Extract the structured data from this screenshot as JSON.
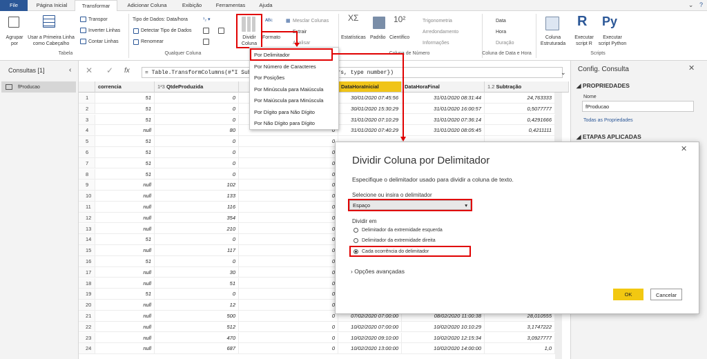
{
  "tabs": [
    "File",
    "Página Inicial",
    "Transformar",
    "Adicionar Coluna",
    "Exibição",
    "Ferramentas",
    "Ajuda"
  ],
  "ribbon": {
    "tabela": {
      "agrupar": "Agrupar por",
      "usar_primeira": "Usar a Primeira Linha como Cabeçalho",
      "transpor": "Transpor",
      "inverter": "Inverter Linhas",
      "contar": "Contar Linhas",
      "group": "Tabela"
    },
    "qualquer": {
      "tipo": "Tipo de Dados: Data/hora",
      "detectar": "Detectar Tipo de Dados",
      "renomear": "Renomear",
      "dividir": "Dividir Coluna",
      "formato": "Formato",
      "mesclar": "Mesclar Colunas",
      "extrair": "Extrair",
      "analisar": "Analisar",
      "group": "Qualquer Coluna"
    },
    "numero": {
      "estatisticas": "Estatísticas",
      "padrao": "Padrão",
      "cientifico": "Científico",
      "trig": "Trigonometria",
      "arred": "Arredondamento",
      "info": "Informações",
      "group": "Coluna de Número"
    },
    "data": {
      "data": "Data",
      "hora": "Hora",
      "duracao": "Duração",
      "group": "Coluna de Data e Hora"
    },
    "estruturada": "Coluna Estruturada",
    "scripts": {
      "r": "Executar script R",
      "py": "Executar script Python",
      "group": "Scripts"
    }
  },
  "left": {
    "title": "Consultas [1]",
    "query": "fProducao"
  },
  "formula": "= Table.TransformColumns(#\"I                                  Subtração\", Duration.TotalHours, type number})",
  "columns": [
    "correncia",
    "QtdeProduzida",
    "",
    "DataHoraInicial",
    "DataHoraFinal",
    "Subtração"
  ],
  "rows": [
    [
      "1",
      "51",
      "0",
      "0",
      "30/01/2020 07:45:56",
      "31/01/2020 08:31:44",
      "24,763333"
    ],
    [
      "2",
      "51",
      "0",
      "0",
      "30/01/2020 15:30:29",
      "31/01/2020 16:00:57",
      "0,5077777"
    ],
    [
      "3",
      "51",
      "0",
      "0",
      "31/01/2020 07:10:29",
      "31/01/2020 07:36:14",
      "0,4291666"
    ],
    [
      "4",
      "null",
      "80",
      "0",
      "31/01/2020 07:40:29",
      "31/01/2020 08:05:45",
      "0,4211111"
    ],
    [
      "5",
      "51",
      "0",
      "0",
      "",
      "",
      ""
    ],
    [
      "6",
      "51",
      "0",
      "0",
      "",
      "",
      ""
    ],
    [
      "7",
      "51",
      "0",
      "0",
      "",
      "",
      ""
    ],
    [
      "8",
      "51",
      "0",
      "0",
      "",
      "",
      ""
    ],
    [
      "9",
      "null",
      "102",
      "0",
      "",
      "",
      ""
    ],
    [
      "10",
      "null",
      "133",
      "0",
      "",
      "",
      ""
    ],
    [
      "11",
      "null",
      "116",
      "0",
      "",
      "",
      ""
    ],
    [
      "12",
      "null",
      "354",
      "0",
      "",
      "",
      ""
    ],
    [
      "13",
      "null",
      "210",
      "0",
      "",
      "",
      ""
    ],
    [
      "14",
      "51",
      "0",
      "0",
      "",
      "",
      ""
    ],
    [
      "15",
      "null",
      "117",
      "0",
      "",
      "",
      ""
    ],
    [
      "16",
      "51",
      "0",
      "0",
      "",
      "",
      ""
    ],
    [
      "17",
      "null",
      "30",
      "0",
      "",
      "",
      ""
    ],
    [
      "18",
      "null",
      "51",
      "0",
      "",
      "",
      ""
    ],
    [
      "19",
      "51",
      "0",
      "0",
      "",
      "",
      ""
    ],
    [
      "20",
      "null",
      "12",
      "0",
      "",
      "",
      ""
    ],
    [
      "21",
      "null",
      "500",
      "0",
      "07/02/2020 07:00:00",
      "08/02/2020 11:00:38",
      "28,010555"
    ],
    [
      "22",
      "null",
      "512",
      "0",
      "10/02/2020 07:00:00",
      "10/02/2020 10:10:29",
      "3,1747222"
    ],
    [
      "23",
      "null",
      "470",
      "0",
      "10/02/2020 09:10:00",
      "10/02/2020 12:15:34",
      "3,0927777"
    ],
    [
      "24",
      "null",
      "687",
      "0",
      "10/02/2020 13:00:00",
      "10/02/2020 14:00:00",
      "1,0"
    ]
  ],
  "menu": [
    "Por Delimitador",
    "Por Número de Caracteres",
    "Por Posições",
    "Por Minúscula para Maiúscula",
    "Por Maiúscula para Minúscula",
    "Por Dígito para Não Dígito",
    "Por Não Dígito para Dígito"
  ],
  "right": {
    "title": "Config. Consulta",
    "props": "PROPRIEDADES",
    "nome_label": "Nome",
    "nome_value": "fProducao",
    "todas": "Todas as Propriedades",
    "etapas": "ETAPAS APLICADAS"
  },
  "dialog": {
    "title": "Dividir Coluna por Delimitador",
    "desc": "Especifique o delimitador usado para dividir a coluna de texto.",
    "sel_label": "Selecione ou insira o delimitador",
    "sel_value": "Espaço",
    "split_label": "Dividir em",
    "opt1": "Delimitador da extremidade esquerda",
    "opt2": "Delimitador da extremidade direita",
    "opt3": "Cada ocorrência do delimitador",
    "advanced": "Opções avançadas",
    "ok": "OK",
    "cancel": "Cancelar"
  },
  "colors": {
    "accent": "#f0c419",
    "red": "#e00000",
    "file_tab": "#2b5797"
  }
}
